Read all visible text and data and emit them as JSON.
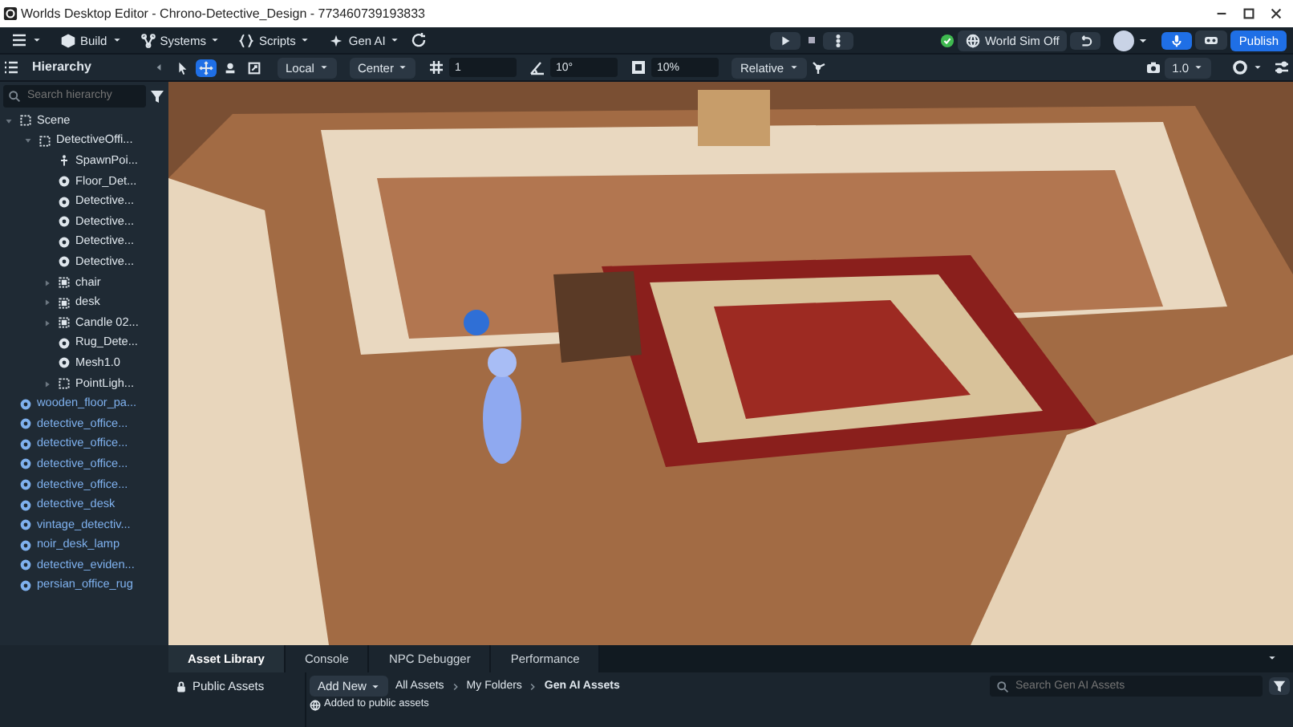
{
  "window": {
    "title": "Worlds Desktop Editor - Chrono-Detective_Design - 773460739193833"
  },
  "menubar": {
    "menus": [
      {
        "label": "Build",
        "kind": "cube"
      },
      {
        "label": "Systems",
        "kind": "nodes"
      },
      {
        "label": "Scripts",
        "kind": "braces"
      },
      {
        "label": "Gen AI",
        "kind": "sparkle"
      }
    ],
    "world_sim": {
      "label": "World Sim Off",
      "synced": true
    },
    "publish": "Publish"
  },
  "toolbar": {
    "panel_title": "Hierarchy",
    "tools": [
      {
        "kind": "select",
        "selected": false
      },
      {
        "kind": "move",
        "selected": true
      },
      {
        "kind": "pivot",
        "selected": false
      },
      {
        "kind": "scale",
        "selected": false
      }
    ],
    "dropdowns": [
      "Local",
      "Center"
    ],
    "snap_fields": [
      {
        "kind": "grid",
        "value": "1"
      },
      {
        "kind": "angle",
        "value": "10°"
      },
      {
        "kind": "scale",
        "value": "10%"
      }
    ],
    "space": "Relative",
    "camera_speed": "1.0"
  },
  "hierarchy": {
    "search_placeholder": "Search hierarchy",
    "items": [
      {
        "label": "Scene",
        "kind": "group",
        "expanded": true,
        "children": [
          {
            "label": "DetectiveOffi...",
            "kind": "group",
            "expanded": true,
            "children": [
              {
                "label": "SpawnPoi...",
                "kind": "spawn"
              },
              {
                "label": "Floor_Det...",
                "kind": "mesh"
              },
              {
                "label": "Detective...",
                "kind": "mesh"
              },
              {
                "label": "Detective...",
                "kind": "mesh"
              },
              {
                "label": "Detective...",
                "kind": "mesh"
              },
              {
                "label": "Detective...",
                "kind": "mesh"
              },
              {
                "label": "chair",
                "kind": "entity",
                "expanded": false
              },
              {
                "label": "desk",
                "kind": "entity",
                "expanded": false
              },
              {
                "label": "Candle 02...",
                "kind": "entity",
                "expanded": false
              },
              {
                "label": "Rug_Dete...",
                "kind": "mesh"
              },
              {
                "label": "Mesh1.0",
                "kind": "mesh"
              },
              {
                "label": "PointLigh...",
                "kind": "group",
                "expanded": false
              }
            ]
          }
        ]
      },
      {
        "label": "wooden_floor_pa...",
        "kind": "asset"
      },
      {
        "label": "detective_office...",
        "kind": "asset"
      },
      {
        "label": "detective_office...",
        "kind": "asset"
      },
      {
        "label": "detective_office...",
        "kind": "asset"
      },
      {
        "label": "detective_office...",
        "kind": "asset"
      },
      {
        "label": "detective_desk",
        "kind": "asset"
      },
      {
        "label": "vintage_detectiv...",
        "kind": "asset"
      },
      {
        "label": "noir_desk_lamp",
        "kind": "asset"
      },
      {
        "label": "detective_eviden...",
        "kind": "asset"
      },
      {
        "label": "persian_office_rug",
        "kind": "asset"
      }
    ]
  },
  "bottom_panel": {
    "tabs": [
      {
        "label": "Asset Library",
        "selected": true
      },
      {
        "label": "Console",
        "selected": false
      },
      {
        "label": "NPC Debugger",
        "selected": false
      },
      {
        "label": "Performance",
        "selected": false
      }
    ],
    "sidebar": [
      {
        "label": "Public Assets",
        "selected": false
      }
    ],
    "add_button": "Add New",
    "breadcrumb": [
      "All Assets",
      "My Folders",
      "Gen AI Assets"
    ],
    "search_placeholder": "Search Gen AI Assets",
    "rows": [
      "Added to public assets"
    ]
  }
}
